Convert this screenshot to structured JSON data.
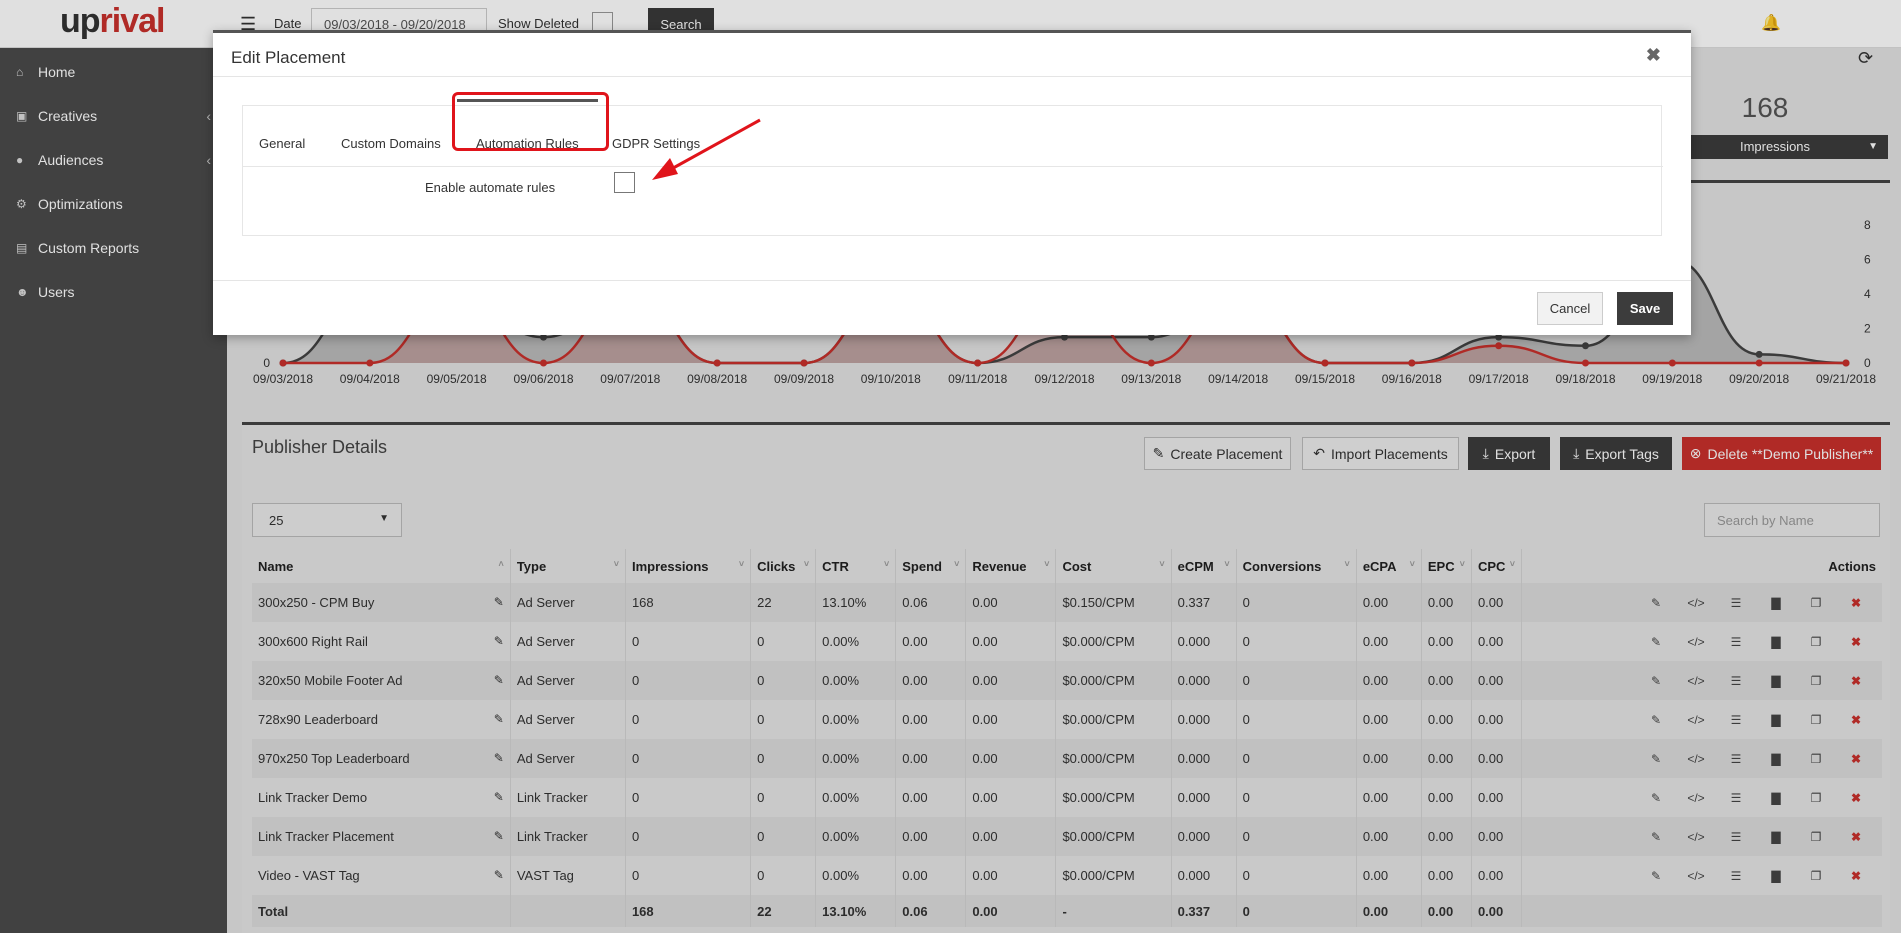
{
  "app": {
    "logo_prefix": "up",
    "logo_suffix": "rival"
  },
  "topbar": {
    "date_label": "Date",
    "date_value": "09/03/2018 - 09/20/2018",
    "show_deleted_label": "Show Deleted",
    "search_label": "Search"
  },
  "sidebar": {
    "items": [
      {
        "label": "Home",
        "icon": "home-icon",
        "has_chevron": false
      },
      {
        "label": "Creatives",
        "icon": "image-icon",
        "has_chevron": true
      },
      {
        "label": "Audiences",
        "icon": "users-icon",
        "has_chevron": true
      },
      {
        "label": "Optimizations",
        "icon": "cogs-icon",
        "has_chevron": false
      },
      {
        "label": "Custom Reports",
        "icon": "file-icon",
        "has_chevron": false
      },
      {
        "label": "Users",
        "icon": "user-icon",
        "has_chevron": false
      }
    ]
  },
  "kpi": {
    "value": "168",
    "metric": "Impressions"
  },
  "chart_data": {
    "type": "area",
    "x": [
      "09/03/2018",
      "09/04/2018",
      "09/05/2018",
      "09/06/2018",
      "09/07/2018",
      "09/08/2018",
      "09/09/2018",
      "09/10/2018",
      "09/11/2018",
      "09/12/2018",
      "09/13/2018",
      "09/14/2018",
      "09/15/2018",
      "09/16/2018",
      "09/17/2018",
      "09/18/2018",
      "09/19/2018",
      "09/20/2018",
      "09/21/2018"
    ],
    "y_left_ticks": [
      "0"
    ],
    "y_right_ticks": [
      "0",
      "2",
      "4",
      "6",
      "8"
    ],
    "series": [
      {
        "values": [
          0,
          4,
          4,
          1.5,
          4,
          0,
          0,
          4,
          0,
          1.5,
          1.5,
          4,
          0,
          0,
          1.5,
          1,
          6,
          0.5,
          0
        ],
        "color": "#444444"
      },
      {
        "values": [
          0,
          0,
          4,
          0,
          4,
          0,
          0,
          4,
          0,
          4,
          0,
          4,
          0,
          0,
          1,
          0,
          0,
          0,
          0
        ],
        "color": "#c9302c"
      }
    ]
  },
  "publisher": {
    "title": "Publisher Details",
    "buttons": {
      "create": "Create Placement",
      "import": "Import Placements",
      "export": "Export",
      "export_tags": "Export Tags",
      "delete": "Delete **Demo Publisher**"
    },
    "page_size": "25",
    "search_placeholder": "Search by Name",
    "columns": [
      "Name",
      "Type",
      "Impressions",
      "Clicks",
      "CTR",
      "Spend",
      "Revenue",
      "Cost",
      "eCPM",
      "Conversions",
      "eCPA",
      "EPC",
      "CPC",
      "Actions"
    ],
    "rows": [
      [
        "300x250 - CPM Buy",
        "Ad Server",
        "168",
        "22",
        "13.10%",
        "0.06",
        "0.00",
        "$0.150/CPM",
        "0.337",
        "0",
        "0.00",
        "0.00",
        "0.00"
      ],
      [
        "300x600 Right Rail",
        "Ad Server",
        "0",
        "0",
        "0.00%",
        "0.00",
        "0.00",
        "$0.000/CPM",
        "0.000",
        "0",
        "0.00",
        "0.00",
        "0.00"
      ],
      [
        "320x50 Mobile Footer Ad",
        "Ad Server",
        "0",
        "0",
        "0.00%",
        "0.00",
        "0.00",
        "$0.000/CPM",
        "0.000",
        "0",
        "0.00",
        "0.00",
        "0.00"
      ],
      [
        "728x90 Leaderboard",
        "Ad Server",
        "0",
        "0",
        "0.00%",
        "0.00",
        "0.00",
        "$0.000/CPM",
        "0.000",
        "0",
        "0.00",
        "0.00",
        "0.00"
      ],
      [
        "970x250 Top Leaderboard",
        "Ad Server",
        "0",
        "0",
        "0.00%",
        "0.00",
        "0.00",
        "$0.000/CPM",
        "0.000",
        "0",
        "0.00",
        "0.00",
        "0.00"
      ],
      [
        "Link Tracker Demo",
        "Link Tracker",
        "0",
        "0",
        "0.00%",
        "0.00",
        "0.00",
        "$0.000/CPM",
        "0.000",
        "0",
        "0.00",
        "0.00",
        "0.00"
      ],
      [
        "Link Tracker Placement",
        "Link Tracker",
        "0",
        "0",
        "0.00%",
        "0.00",
        "0.00",
        "$0.000/CPM",
        "0.000",
        "0",
        "0.00",
        "0.00",
        "0.00"
      ],
      [
        "Video - VAST Tag",
        "VAST Tag",
        "0",
        "0",
        "0.00%",
        "0.00",
        "0.00",
        "$0.000/CPM",
        "0.000",
        "0",
        "0.00",
        "0.00",
        "0.00"
      ]
    ],
    "total": [
      "Total",
      "",
      "168",
      "22",
      "13.10%",
      "0.06",
      "0.00",
      "-",
      "0.337",
      "0",
      "0.00",
      "0.00",
      "0.00"
    ]
  },
  "modal": {
    "title": "Edit Placement",
    "tabs": [
      "General",
      "Custom Domains",
      "Automation Rules",
      "GDPR Settings"
    ],
    "active_tab": "Automation Rules",
    "enable_label": "Enable automate rules",
    "cancel_label": "Cancel",
    "save_label": "Save"
  },
  "colors": {
    "accent_red": "#c9302c",
    "highlight_red": "#e0141b",
    "sidebar_bg": "#4a4a4a",
    "dark_button": "#3c3c3c"
  }
}
